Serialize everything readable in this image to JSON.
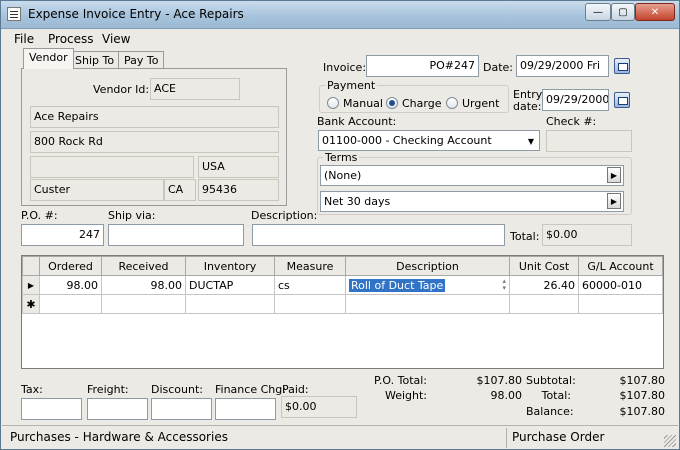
{
  "window": {
    "title": "Expense Invoice Entry - Ace Repairs",
    "min_glyph": "—",
    "max_glyph": "▢",
    "close_glyph": "✕"
  },
  "menu": {
    "file": "File",
    "process": "Process",
    "view": "View"
  },
  "tabs": {
    "vendor": "Vendor",
    "ship_to": "Ship To",
    "pay_to": "Pay To"
  },
  "vendor": {
    "id_label": "Vendor Id:",
    "id": "ACE",
    "name": "Ace Repairs",
    "address1": "800 Rock Rd",
    "address2": "",
    "country": "USA",
    "city": "Custer",
    "state": "CA",
    "zip": "95436"
  },
  "invoice": {
    "label": "Invoice:",
    "value": "PO#247",
    "date_label": "Date:",
    "date": "09/29/2000 Fri",
    "entry_date_label_1": "Entry",
    "entry_date_label_2": "date:",
    "entry_date": "09/29/2000"
  },
  "payment": {
    "label": "Payment",
    "options": [
      "Manual",
      "Charge",
      "Urgent"
    ],
    "selected": "Charge"
  },
  "bank": {
    "label": "Bank Account:",
    "value": "01100-000 - Checking Account",
    "check_label": "Check #:",
    "check_value": ""
  },
  "terms": {
    "label": "Terms",
    "terms1": "(None)",
    "terms2": "Net  30 days"
  },
  "po_row": {
    "po_label": "P.O. #:",
    "po_value": "247",
    "ship_via_label": "Ship via:",
    "ship_via_value": "",
    "description_label": "Description:",
    "description_value": "",
    "total_label": "Total:",
    "total_value": "$0.00"
  },
  "grid": {
    "columns": [
      "Ordered",
      "Received",
      "Inventory",
      "Measure",
      "Description",
      "Unit Cost",
      "G/L Account"
    ],
    "rows": [
      [
        "98.00",
        "98.00",
        "DUCTAP",
        "cs",
        "Roll of Duct Tape",
        "26.40",
        "60000-010"
      ]
    ],
    "current_row_marker": "▶",
    "new_row_marker": "✱"
  },
  "footer": {
    "tax_label": "Tax:",
    "tax_value": "",
    "freight_label": "Freight:",
    "freight_value": "",
    "discount_label": "Discount:",
    "discount_value": "",
    "finance_label": "Finance Chg:",
    "finance_value": "",
    "paid_label": "Paid:",
    "paid_value": "$0.00",
    "po_total_label": "P.O. Total:",
    "po_total_value": "$107.80",
    "weight_label": "Weight:",
    "weight_value": "98.00",
    "subtotal_label": "Subtotal:",
    "subtotal_value": "$107.80",
    "total_label": "Total:",
    "total_value": "$107.80",
    "balance_label": "Balance:",
    "balance_value": "$107.80"
  },
  "status": {
    "left": "Purchases - Hardware & Accessories",
    "right": "Purchase Order"
  },
  "colors": {
    "selection": "#3173c7",
    "window_bg": "#eceae4",
    "title_gradient_top": "#c9dcec"
  }
}
